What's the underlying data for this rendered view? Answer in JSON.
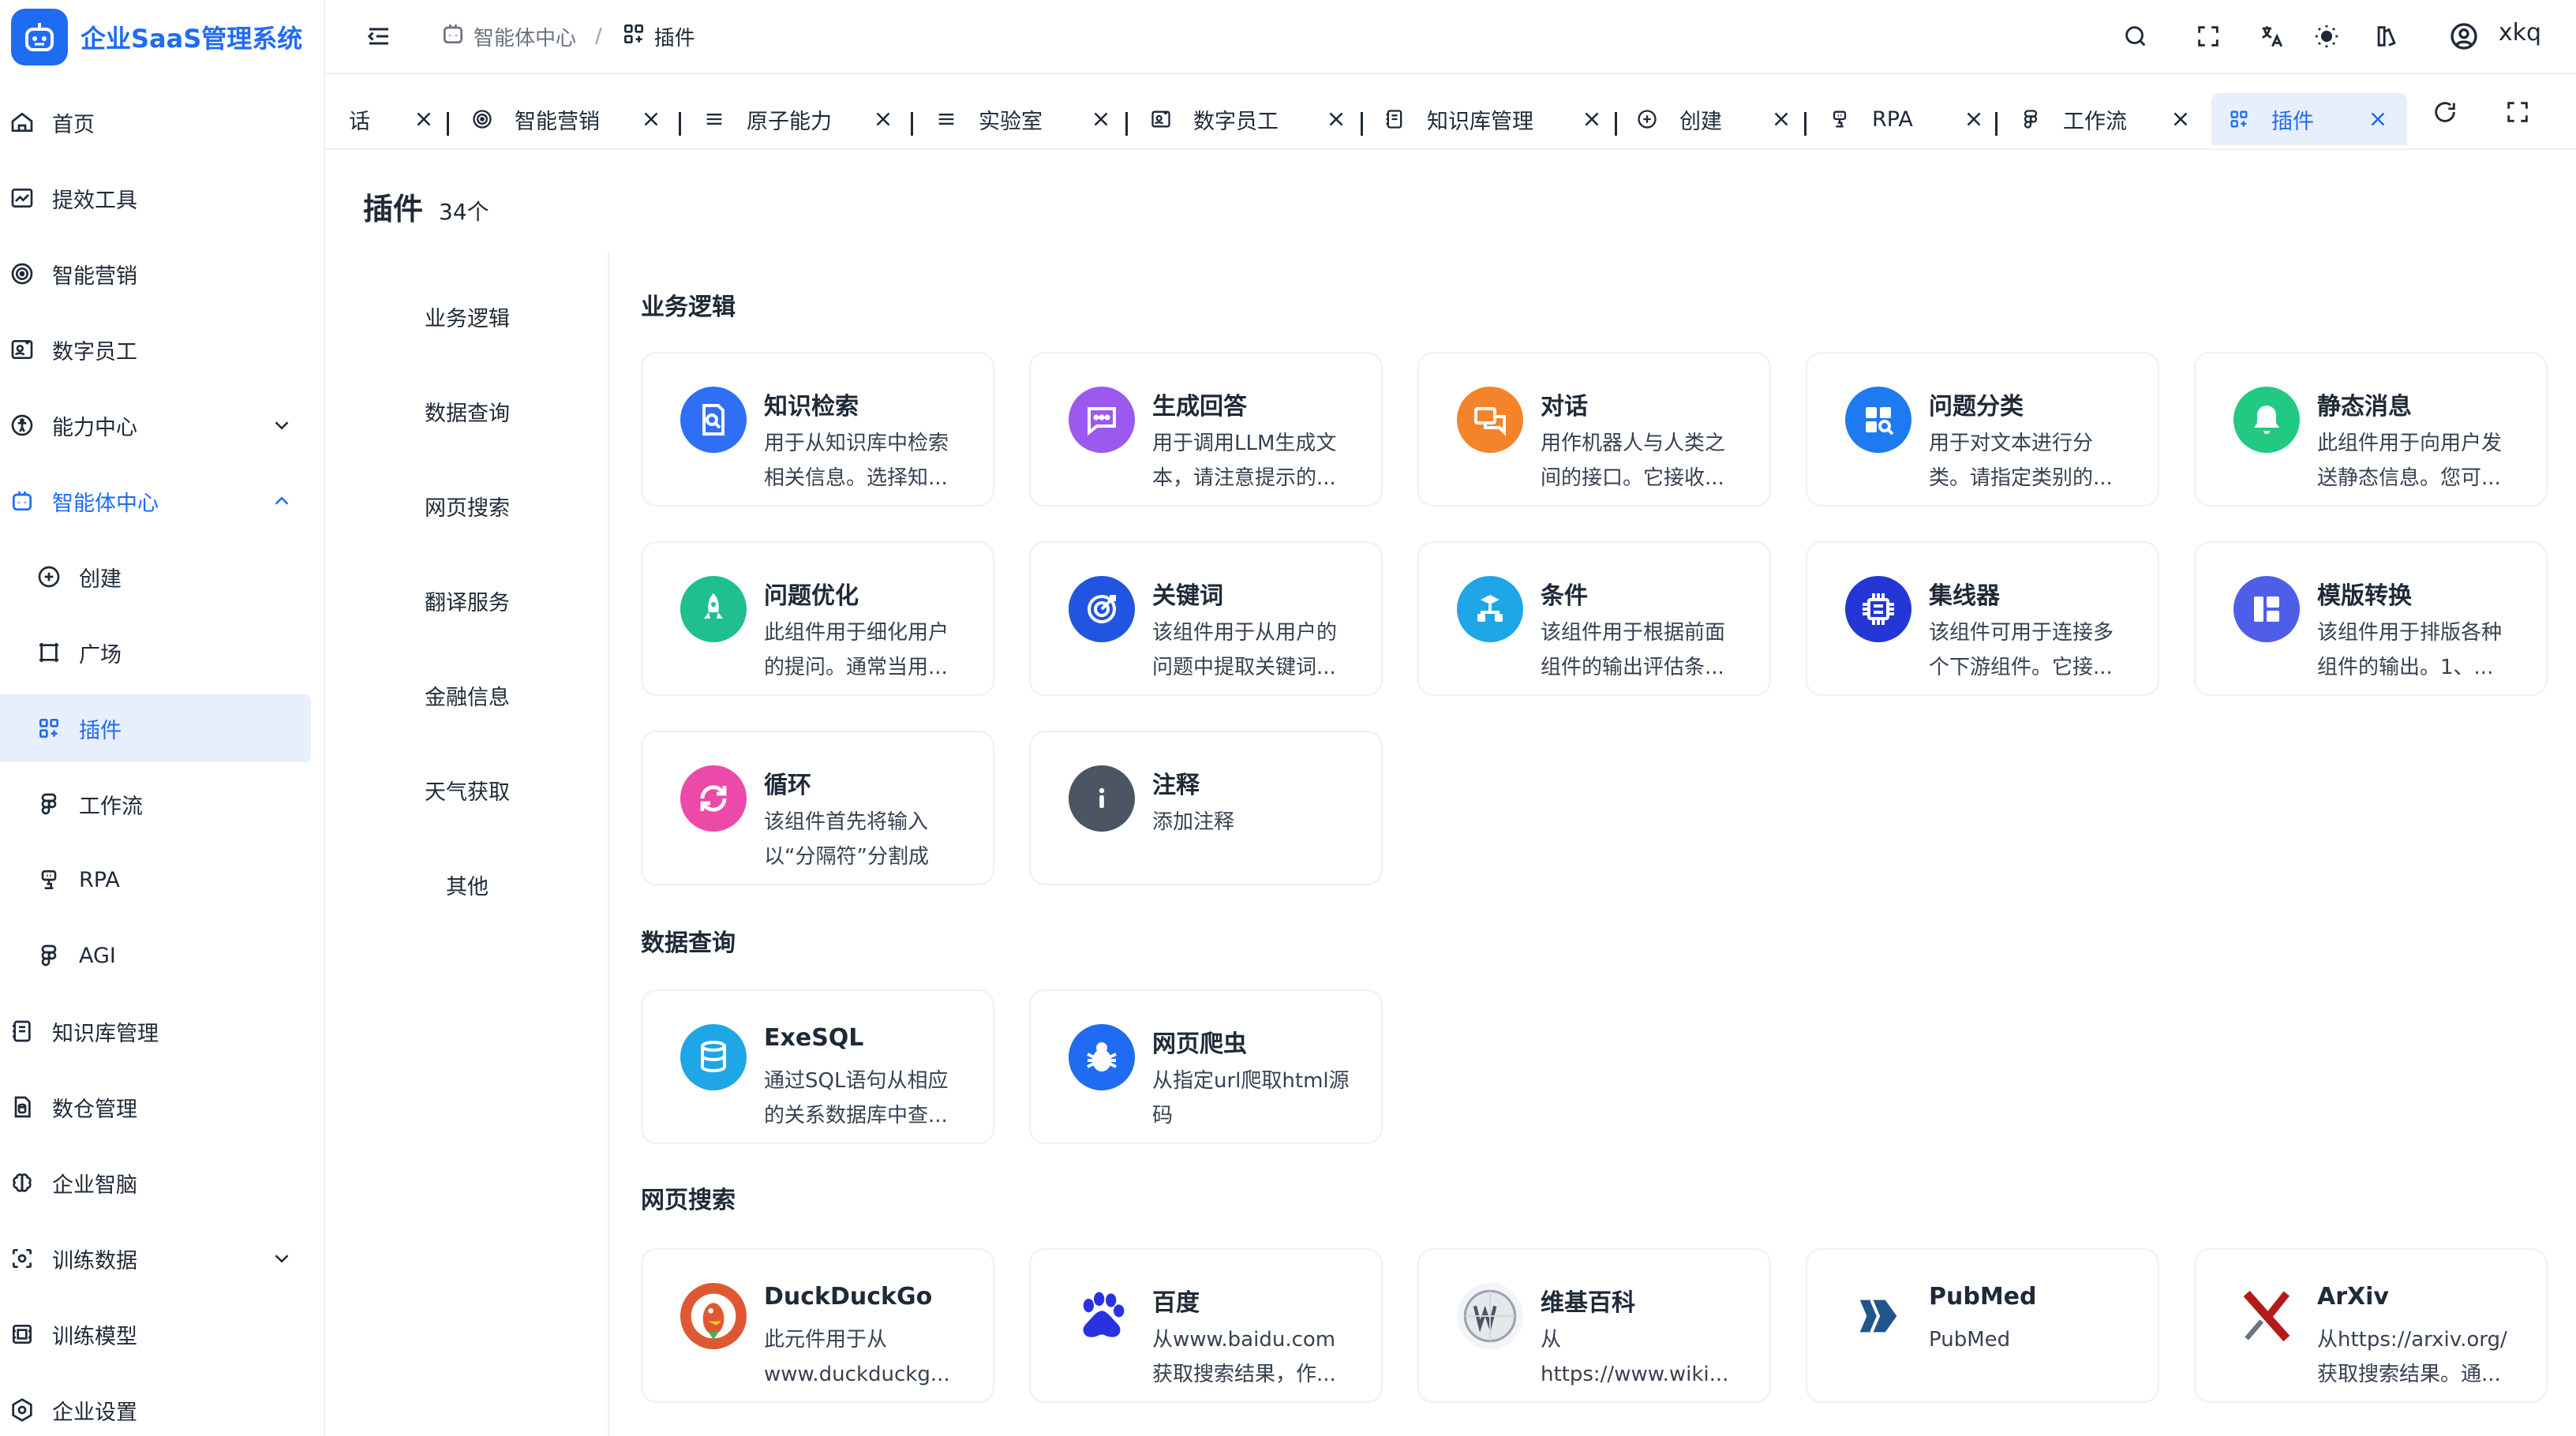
{
  "app": {
    "name": "企业SaaS管理系统"
  },
  "sidebar": {
    "items": [
      {
        "label": "首页",
        "icon": "home-icon"
      },
      {
        "label": "提效工具",
        "icon": "chart-line-icon"
      },
      {
        "label": "智能营销",
        "icon": "target-icon"
      },
      {
        "label": "数字员工",
        "icon": "user-badge-icon"
      },
      {
        "label": "能力中心",
        "icon": "accessibility-icon"
      },
      {
        "label": "智能体中心",
        "icon": "robot-icon"
      },
      {
        "label": "创建",
        "icon": "plus-circle-icon"
      },
      {
        "label": "广场",
        "icon": "frame-icon"
      },
      {
        "label": "插件",
        "icon": "apps-add-icon"
      },
      {
        "label": "工作流",
        "icon": "figma-icon"
      },
      {
        "label": "RPA",
        "icon": "robot-arm-icon"
      },
      {
        "label": "AGI",
        "icon": "figma-icon"
      },
      {
        "label": "知识库管理",
        "icon": "notebook-icon"
      },
      {
        "label": "数仓管理",
        "icon": "database-file-icon"
      },
      {
        "label": "企业智脑",
        "icon": "brain-icon"
      },
      {
        "label": "训练数据",
        "icon": "scan-icon"
      },
      {
        "label": "训练模型",
        "icon": "model-icon"
      },
      {
        "label": "企业设置",
        "icon": "settings-hex-icon"
      }
    ]
  },
  "header": {
    "breadcrumb": [
      {
        "label": "智能体中心"
      },
      {
        "label": "插件"
      }
    ],
    "user": "xkq"
  },
  "tabs": [
    {
      "label": "话"
    },
    {
      "label": "智能营销"
    },
    {
      "label": "原子能力"
    },
    {
      "label": "实验室"
    },
    {
      "label": "数字员工"
    },
    {
      "label": "知识库管理"
    },
    {
      "label": "创建"
    },
    {
      "label": "RPA"
    },
    {
      "label": "工作流"
    },
    {
      "label": "插件"
    }
  ],
  "page": {
    "title": "插件",
    "count": "34个"
  },
  "categories": [
    "业务逻辑",
    "数据查询",
    "网页搜索",
    "翻译服务",
    "金融信息",
    "天气获取",
    "其他"
  ],
  "sections": [
    {
      "title": "业务逻辑",
      "cards": [
        {
          "title": "知识检索",
          "desc": "用于从知识库中检索相关信息。选择知...",
          "icon": "doc-search-icon",
          "color": "#2f6ff5"
        },
        {
          "title": "生成回答",
          "desc": "用于调用LLM生成文本，请注意提示的...",
          "icon": "chat-bubble-icon",
          "color": "#9b59f0"
        },
        {
          "title": "对话",
          "desc": "用作机器人与人类之间的接口。它接收...",
          "icon": "dialog-icon",
          "color": "#f5832a"
        },
        {
          "title": "问题分类",
          "desc": "用于对文本进行分类。请指定类别的...",
          "icon": "grid-search-icon",
          "color": "#1e7af0"
        },
        {
          "title": "静态消息",
          "desc": "此组件用于向用户发送静态信息。您可...",
          "icon": "bell-icon",
          "color": "#22c983"
        },
        {
          "title": "问题优化",
          "desc": "此组件用于细化用户的提问。通常当用...",
          "icon": "rocket-icon",
          "color": "#1fbf8f"
        },
        {
          "title": "关键词",
          "desc": "该组件用于从用户的问题中提取关键词...",
          "icon": "target-arrow-icon",
          "color": "#1f55e0"
        },
        {
          "title": "条件",
          "desc": "该组件用于根据前面组件的输出评估条...",
          "icon": "tree-icon",
          "color": "#1fa6e6"
        },
        {
          "title": "集线器",
          "desc": "该组件可用于连接多个下游组件。它接...",
          "icon": "chip-icon",
          "color": "#2437d6"
        },
        {
          "title": "模版转换",
          "desc": "该组件用于排版各种组件的输出。1、...",
          "icon": "layout-icon",
          "color": "#4f5ee8"
        },
        {
          "title": "循环",
          "desc": "该组件首先将输入以“分隔符”分割成数...",
          "icon": "loop-icon",
          "color": "#ec4aa8"
        },
        {
          "title": "注释",
          "desc": "添加注释",
          "icon": "info-icon",
          "color": "#4b5563"
        }
      ]
    },
    {
      "title": "数据查询",
      "cards": [
        {
          "title": "ExeSQL",
          "desc": "通过SQL语句从相应的关系数据库中查...",
          "icon": "sql-icon",
          "color": "#1fa6e6"
        },
        {
          "title": "网页爬虫",
          "desc": "从指定url爬取html源码",
          "icon": "bug-icon",
          "color": "#1f6bf2"
        }
      ]
    },
    {
      "title": "网页搜索",
      "cards": [
        {
          "title": "DuckDuckGo",
          "desc": "此元件用于从www.duckduckg...",
          "icon": "duckduckgo-icon",
          "color": "#de5833"
        },
        {
          "title": "百度",
          "desc": "从www.baidu.com获取搜索结果，作...",
          "icon": "baidu-icon",
          "color": "#2932e1"
        },
        {
          "title": "维基百科",
          "desc": "从https://www.wiki...",
          "icon": "wikipedia-icon",
          "color": "#9ca3af"
        },
        {
          "title": "PubMed",
          "desc": "PubMed",
          "icon": "pubmed-icon",
          "color": "#20558a"
        },
        {
          "title": "ArXiv",
          "desc": "从https://arxiv.org/获取搜索结果。通...",
          "icon": "arxiv-icon",
          "color": "#b31b1b"
        }
      ]
    }
  ]
}
